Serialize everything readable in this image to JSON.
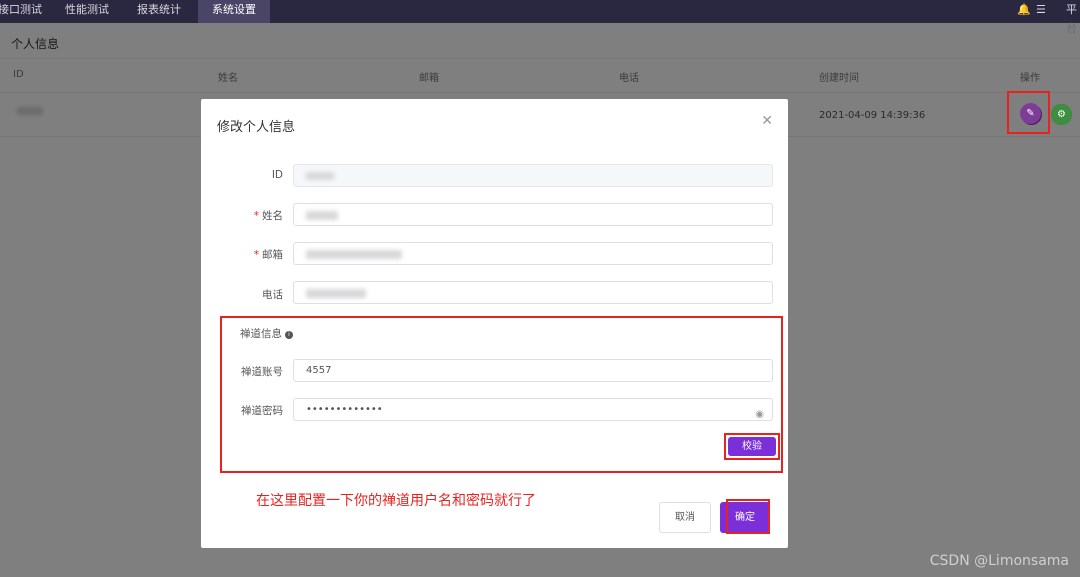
{
  "nav": {
    "items": [
      {
        "label": "接口测试"
      },
      {
        "label": "性能测试"
      },
      {
        "label": "报表统计"
      },
      {
        "label": "系统设置"
      }
    ],
    "right_text": "平台"
  },
  "page": {
    "title": "个人信息",
    "columns": [
      "ID",
      "姓名",
      "邮箱",
      "电话",
      "创建时间",
      "操作"
    ],
    "row": {
      "created": "2021-04-09 14:39:36"
    }
  },
  "modal": {
    "title": "修改个人信息",
    "fields": {
      "id_label": "ID",
      "name_label": "姓名",
      "email_label": "邮箱",
      "phone_label": "电话"
    },
    "zentao": {
      "section_label": "禅道信息",
      "account_label": "禅道账号",
      "account_value": "4557",
      "password_label": "禅道密码",
      "password_value": "•••••••••••••",
      "verify_label": "校验"
    },
    "cancel_label": "取消",
    "confirm_label": "确定"
  },
  "annotation": "在这里配置一下你的禅道用户名和密码就行了",
  "watermark": "CSDN @Limonsama",
  "colors": {
    "nav_bg": "#2a2740",
    "accent": "#7b2fd8",
    "highlight": "#e8231f"
  }
}
